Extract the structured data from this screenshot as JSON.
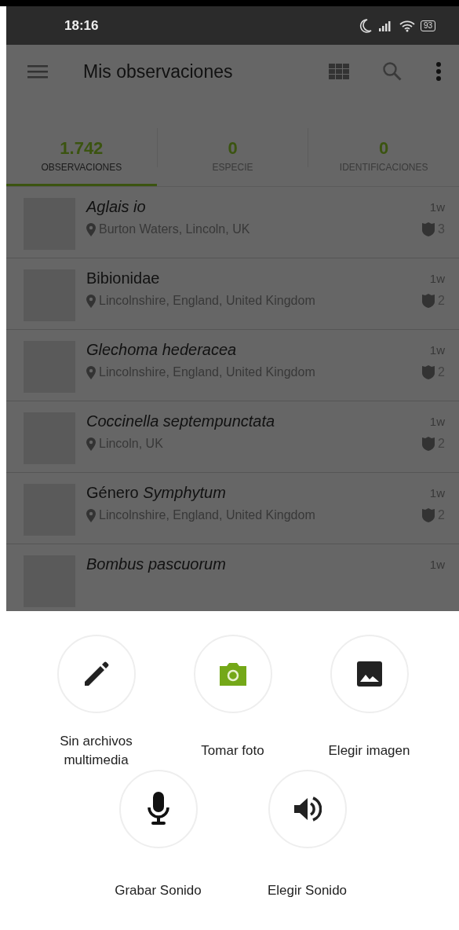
{
  "status_bar": {
    "time": "18:16",
    "battery": "93"
  },
  "app_bar": {
    "title": "Mis observaciones"
  },
  "tabs": [
    {
      "count": "1.742",
      "label": "OBSERVACIONES",
      "selected": true
    },
    {
      "count": "0",
      "label": "ESPECIE",
      "selected": false
    },
    {
      "count": "0",
      "label": "IDENTIFICACIONES",
      "selected": false
    }
  ],
  "observations": [
    {
      "name": "Aglais io",
      "italic": true,
      "place": "Burton Waters, Lincoln, UK",
      "time": "1w",
      "ids": "3"
    },
    {
      "name": "Bibionidae",
      "italic": false,
      "place": "Lincolnshire, England, United Kingdom",
      "time": "1w",
      "ids": "2"
    },
    {
      "name": "Glechoma hederacea",
      "italic": true,
      "place": "Lincolnshire, England, United Kingdom",
      "time": "1w",
      "ids": "2"
    },
    {
      "name": "Coccinella septempunctata",
      "italic": true,
      "place": "Lincoln, UK",
      "time": "1w",
      "ids": "2"
    },
    {
      "name": "Género *Symphytum*",
      "italic": false,
      "place": "Lincolnshire, England, United Kingdom",
      "time": "1w",
      "ids": "2"
    },
    {
      "name": "Bombus pascuorum",
      "italic": true,
      "time": "1w"
    }
  ],
  "media_rows": [
    {
      "options": [
        {
          "kind": "pencil",
          "label": "Sin archivos multimedia"
        },
        {
          "kind": "camera",
          "label": "Tomar foto"
        },
        {
          "kind": "image",
          "label": "Elegir imagen"
        }
      ]
    },
    {
      "options": [
        {
          "kind": "mic",
          "label": "Grabar Sonido"
        },
        {
          "kind": "speaker",
          "label": "Elegir Sonido"
        }
      ]
    }
  ]
}
